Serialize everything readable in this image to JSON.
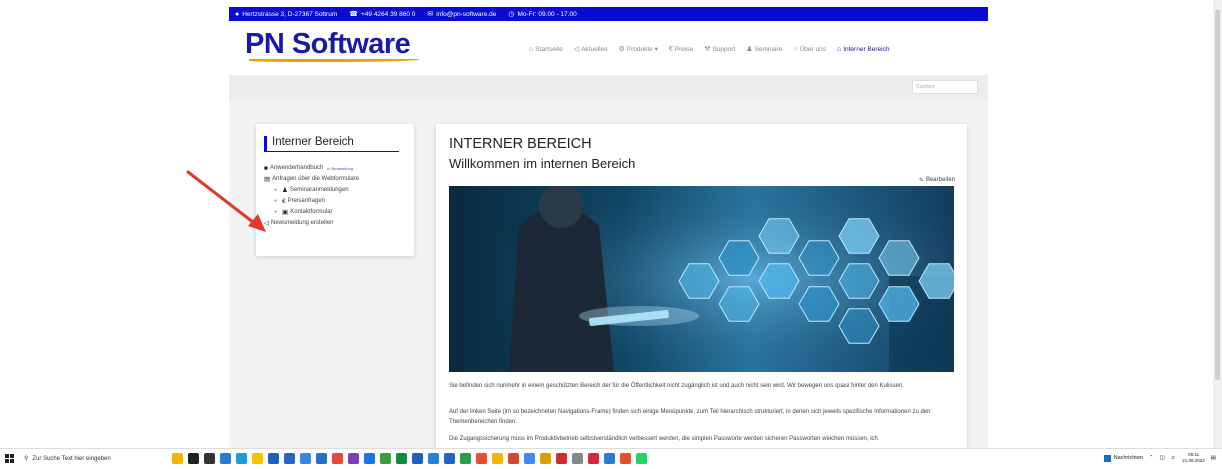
{
  "topbar": {
    "address": "Hertzstrasse 3, D-27367 Sottrum",
    "phone": "+49 4264 39 860 0",
    "email": "info@pn-software.de",
    "hours": "Mo-Fr: 09.00 - 17.00"
  },
  "logo": "PN Software",
  "nav": [
    {
      "label": "Startseite",
      "icon": "home-icon",
      "glyph": "⌂"
    },
    {
      "label": "Aktuelles",
      "icon": "megaphone-icon",
      "glyph": "◁"
    },
    {
      "label": "Produkte ▾",
      "icon": "gear-icon",
      "glyph": "⚙"
    },
    {
      "label": "Preise",
      "icon": "euro-icon",
      "glyph": "€"
    },
    {
      "label": "Support",
      "icon": "wrench-icon",
      "glyph": "⚒"
    },
    {
      "label": "Seminare",
      "icon": "users-icon",
      "glyph": "♟"
    },
    {
      "label": "Über uns",
      "icon": "globe-icon",
      "glyph": "○"
    },
    {
      "label": "Interner Bereich",
      "icon": "lock-icon",
      "glyph": "⌂"
    }
  ],
  "search": {
    "placeholder": "Suchen"
  },
  "sidebar": {
    "title": "Interner Bereich",
    "items": [
      {
        "label": "Anwenderhandbuch",
        "badge": "in Bearbeitung",
        "icon": "book-icon",
        "glyph": "■",
        "sub": false
      },
      {
        "label": "Anfragen über die Webformulare",
        "icon": "form-icon",
        "glyph": "▤",
        "sub": false
      },
      {
        "label": "Seminaranmeldungen",
        "icon": "users-icon",
        "glyph": "♟",
        "sub": true
      },
      {
        "label": "Preisanfragen",
        "icon": "euro-icon",
        "glyph": "€",
        "sub": true
      },
      {
        "label": "Kontaktformular",
        "icon": "briefcase-icon",
        "glyph": "▣",
        "sub": true
      },
      {
        "label": "Newsmeldung erstellen",
        "icon": "megaphone-icon",
        "glyph": "◁",
        "sub": false
      }
    ]
  },
  "main": {
    "title": "INTERNER BEREICH",
    "subtitle": "Willkommen im internen Bereich",
    "edit_label": "Bearbeiten",
    "paragraphs": [
      "Sie befinden sich nunmehr in einem geschützten Bereich der für die Öffentlichkeit nicht zugänglich ist und auch nicht sein wird. Wir bewegen uns quasi hinter den Kulissen.",
      "Auf der linken Seite (im so bezeichneten Navigations-Frame) finden sich einige Menüpunkte, zum Teil hierarchisch strukturiert, in denen sich jeweils spezifische Informationen zu den Themenbereichen finden.",
      "Die Zugangssicherung muss im Produktivbetrieb selbstverständlich verbessert werden, die simplen Passworte werden sicheren Passworten weichen müssen, ich"
    ]
  },
  "taskbar": {
    "search_placeholder": "Zur Suche Text hier eingeben",
    "news_label": "Nachrichten",
    "time": "09:11",
    "date": "21.08.2022"
  },
  "colors": {
    "brand_blue": "#0b0bd6",
    "logo_blue": "#1a1aa6",
    "logo_accent": "#f0a000",
    "arrow": "#e03a2a"
  }
}
